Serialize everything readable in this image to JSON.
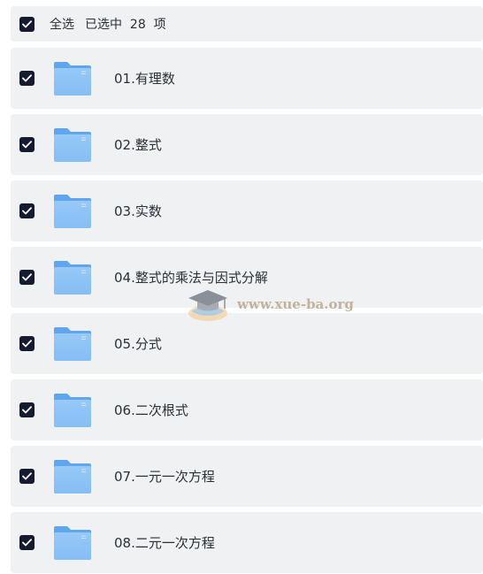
{
  "selection": {
    "select_all_label": "全选",
    "selected_prefix": "已选中",
    "selected_count": "28",
    "selected_suffix": "项"
  },
  "folders": [
    {
      "name": "01.有理数",
      "checked": true
    },
    {
      "name": "02.整式",
      "checked": true
    },
    {
      "name": "03.实数",
      "checked": true
    },
    {
      "name": "04.整式的乘法与因式分解",
      "checked": true
    },
    {
      "name": "05.分式",
      "checked": true
    },
    {
      "name": "06.二次根式",
      "checked": true
    },
    {
      "name": "07.一元一次方程",
      "checked": true
    },
    {
      "name": "08.二元一次方程",
      "checked": true
    }
  ],
  "watermark": {
    "text": "www.xue-ba.org",
    "icon": "graduation-cap-icon"
  },
  "colors": {
    "checkbox": "#151b2e",
    "row_bg": "#f0f1f3",
    "folder_light": "#8ec3f6",
    "folder_dark": "#5fa6ee"
  }
}
